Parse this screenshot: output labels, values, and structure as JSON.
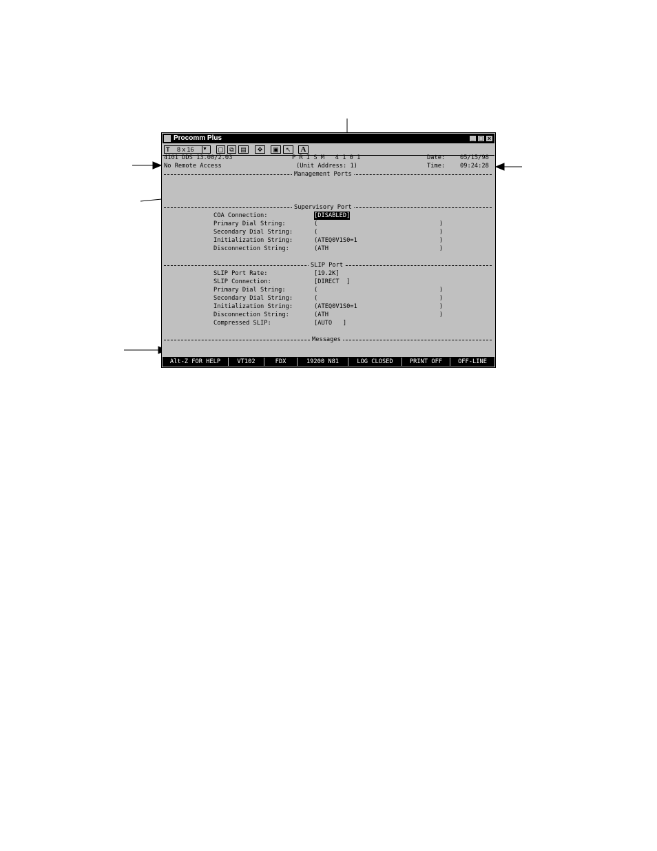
{
  "window": {
    "title": "Procomm Plus",
    "controls": [
      "_",
      "□",
      "×"
    ]
  },
  "toolbar": {
    "font_glyph": "T",
    "font_size": "8 x 16",
    "bold_glyph": "A"
  },
  "header": {
    "version": "4101 DDS 13.00/2.03",
    "remote_access": "No Remote Access",
    "product": "P R I S M   4 1 0 1",
    "unit_address": "(Unit Address: 1)",
    "date_label": "Date:",
    "date_value": "05/15/98",
    "time_label": "Time:",
    "time_value": "09:24:28"
  },
  "sections": {
    "management": "Management Ports",
    "supervisory": "Supervisory Port",
    "slip": "SLIP Port",
    "messages": "Messages"
  },
  "supervisory_fields": [
    {
      "label": "COA Connection:",
      "value": "[DISABLED]"
    },
    {
      "label": "Primary Dial String:",
      "value": "(",
      "close": ")"
    },
    {
      "label": "Secondary Dial String:",
      "value": "(",
      "close": ")"
    },
    {
      "label": "Initialization String:",
      "value": "(ATEQ0V1S0=1",
      "close": ")"
    },
    {
      "label": "Disconnection String:",
      "value": "(ATH",
      "close": ")"
    }
  ],
  "slip_fields": [
    {
      "label": "SLIP Port Rate:",
      "value": "[19.2K]"
    },
    {
      "label": "SLIP Connection:",
      "value": "[DIRECT  ]"
    },
    {
      "label": "Primary Dial String:",
      "value": "(",
      "close": ")"
    },
    {
      "label": "Secondary Dial String:",
      "value": "(",
      "close": ")"
    },
    {
      "label": "Initialization String:",
      "value": "(ATEQ0V1S0=1",
      "close": ")"
    },
    {
      "label": "Disconnection String:",
      "value": "(ATH",
      "close": ")"
    },
    {
      "label": "Compressed SLIP:",
      "value": "[AUTO   ]"
    }
  ],
  "statusbar": [
    "Alt-Z FOR HELP",
    "VT102",
    "FDX",
    "19200 N81",
    "LOG CLOSED",
    "PRINT OFF",
    "OFF-LINE"
  ]
}
